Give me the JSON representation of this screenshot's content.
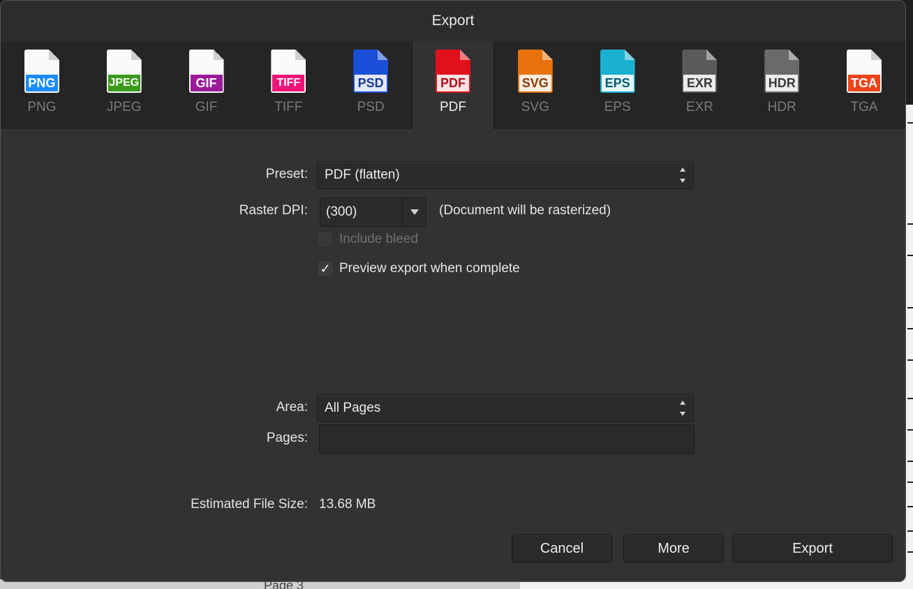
{
  "dialog": {
    "title": "Export"
  },
  "formats": [
    {
      "label": "PNG",
      "badge": "PNG",
      "color": "#1a8cff",
      "style": "band",
      "selected": false,
      "icon": "png-file-icon"
    },
    {
      "label": "JPEG",
      "badge": "JPEG",
      "color": "#3a9a1a",
      "style": "band",
      "selected": false,
      "icon": "jpeg-file-icon"
    },
    {
      "label": "GIF",
      "badge": "GIF",
      "color": "#9a1a9a",
      "style": "band",
      "selected": false,
      "icon": "gif-file-icon"
    },
    {
      "label": "TIFF",
      "badge": "TIFF",
      "color": "#f0147a",
      "style": "band",
      "selected": false,
      "icon": "tiff-file-icon"
    },
    {
      "label": "PSD",
      "badge": "PSD",
      "color": "#1a4fd8",
      "style": "solid",
      "text": "#1a3a9a",
      "selected": false,
      "icon": "psd-file-icon"
    },
    {
      "label": "PDF",
      "badge": "PDF",
      "color": "#e0101c",
      "style": "solid",
      "text": "#b0101a",
      "selected": true,
      "icon": "pdf-file-icon"
    },
    {
      "label": "SVG",
      "badge": "SVG",
      "color": "#e8720c",
      "style": "solid",
      "text": "#8a3a00",
      "selected": false,
      "icon": "svg-file-icon"
    },
    {
      "label": "EPS",
      "badge": "EPS",
      "color": "#1ab0d0",
      "style": "solid",
      "text": "#0a5a70",
      "selected": false,
      "icon": "eps-file-icon"
    },
    {
      "label": "EXR",
      "badge": "EXR",
      "color": "#5a5a5a",
      "style": "solid",
      "text": "#3a3a3a",
      "selected": false,
      "icon": "exr-file-icon"
    },
    {
      "label": "HDR",
      "badge": "HDR",
      "color": "#6a6a6a",
      "style": "solid",
      "text": "#3a3a3a",
      "selected": false,
      "icon": "hdr-file-icon"
    },
    {
      "label": "TGA",
      "badge": "TGA",
      "color": "#f0441a",
      "style": "band",
      "selected": false,
      "icon": "tga-file-icon"
    }
  ],
  "settings": {
    "preset_label": "Preset:",
    "preset_value": "PDF (flatten)",
    "dpi_label": "Raster DPI:",
    "dpi_value": "(300)",
    "dpi_note": "(Document will be rasterized)",
    "bleed_label": "Include bleed",
    "bleed_checked": false,
    "preview_label": "Preview export when complete",
    "preview_checked": true,
    "area_label": "Area:",
    "area_value": "All Pages",
    "pages_label": "Pages:",
    "pages_value": "",
    "size_label": "Estimated File Size:",
    "size_value": "13.68 MB"
  },
  "buttons": {
    "cancel": "Cancel",
    "more": "More",
    "export": "Export"
  },
  "background": {
    "page_label": "Page 3"
  }
}
